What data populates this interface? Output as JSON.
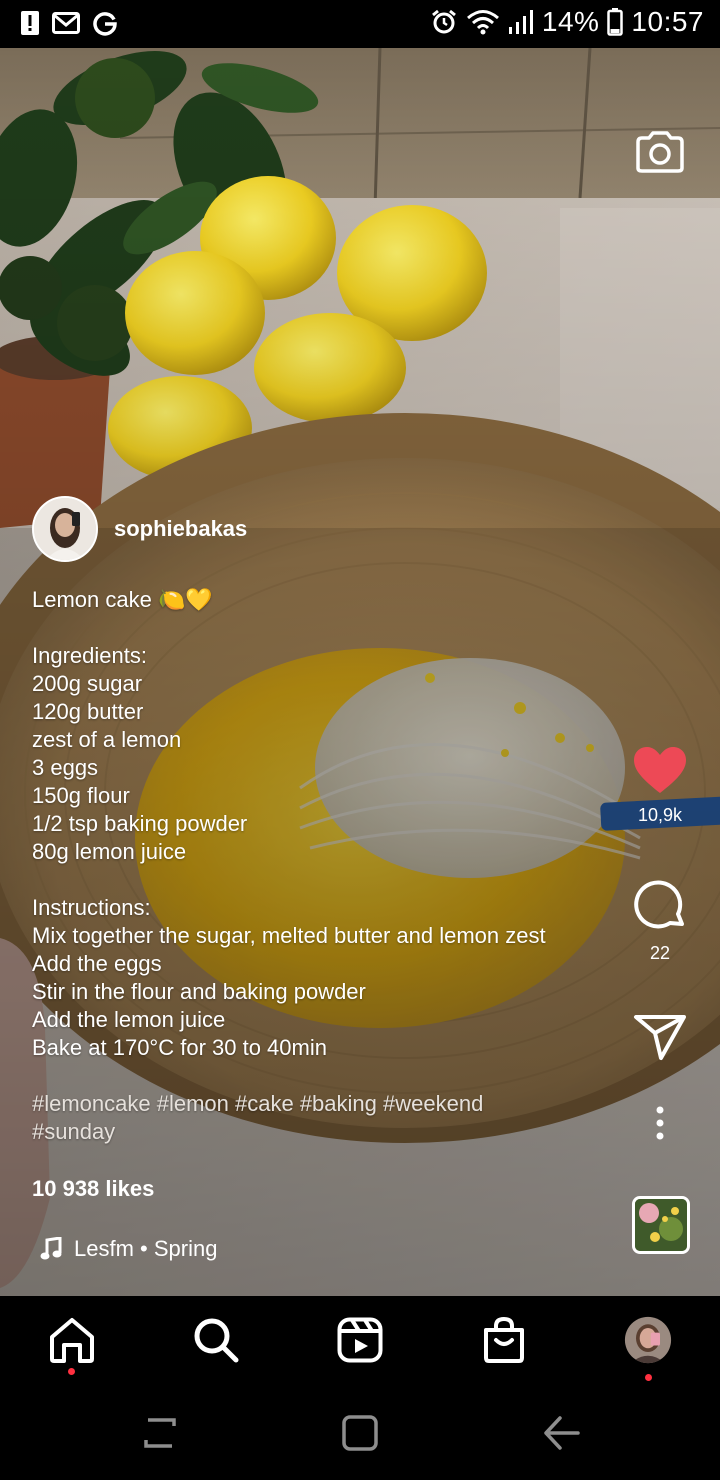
{
  "status_bar": {
    "battery_text": "14%",
    "time": "10:57"
  },
  "post": {
    "username": "sophiebakas",
    "caption_title": "Lemon cake 🍋💛",
    "ingredients_heading": "Ingredients:",
    "ingredients": [
      "200g sugar",
      "120g butter",
      "zest of a lemon",
      "3 eggs",
      "150g flour",
      "1/2 tsp baking powder",
      "80g lemon juice"
    ],
    "instructions_heading": "Instructions:",
    "instructions": [
      "Mix together the sugar, melted butter and lemon zest",
      "Add the eggs",
      "Stir in the flour and baking powder",
      "Add the lemon juice",
      "Bake at 170°C  for 30 to 40min"
    ],
    "hashtags_line1": "#lemoncake #lemon #cake #baking #weekend",
    "hashtags_line2": "#sunday",
    "likes_text": "10 938 likes",
    "music_text": "Lesfm • Spring"
  },
  "actions": {
    "like_count": "10,9k",
    "comment_count": "22"
  },
  "icons": {
    "status_left": [
      "alert-icon",
      "gmail-icon",
      "google-icon"
    ],
    "status_right": [
      "alarm-icon",
      "wifi-icon",
      "signal-icon",
      "battery-icon"
    ],
    "camera": "camera-icon",
    "like": "heart-icon",
    "comment": "comment-icon",
    "share": "send-icon",
    "more": "more-vertical-icon",
    "music": "music-note-icon",
    "nav": [
      "home-icon",
      "search-icon",
      "reels-icon",
      "shop-icon",
      "profile-avatar"
    ]
  },
  "colors": {
    "like_heart": "#ed4956",
    "notification_dot": "#ff3040"
  }
}
